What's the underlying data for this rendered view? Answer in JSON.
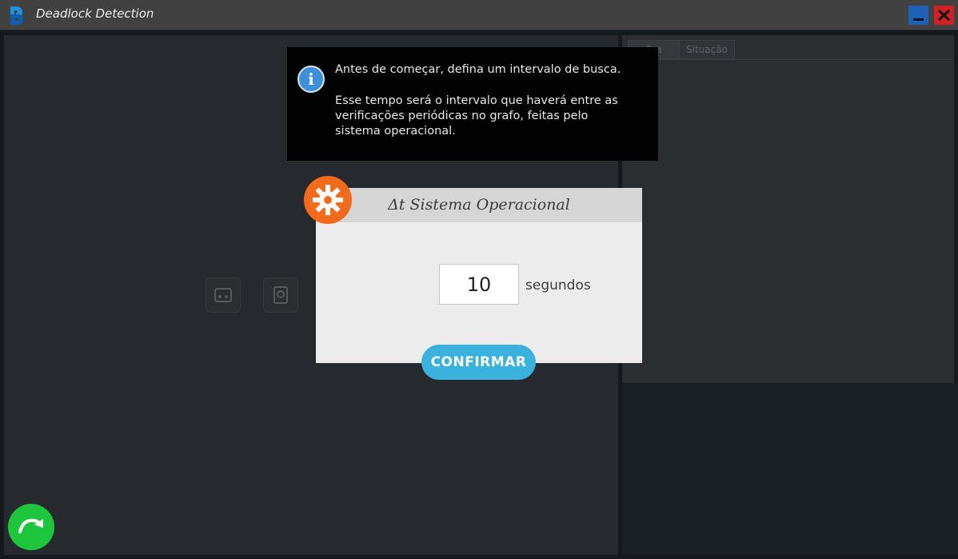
{
  "window": {
    "title": "Deadlock Detection",
    "minimize_icon": "minimize-icon",
    "close_icon": "close-icon"
  },
  "right_panel": {
    "tabs": [
      {
        "label": "Gra"
      },
      {
        "label": "Situação"
      }
    ]
  },
  "info": {
    "icon": "info-icon",
    "line1": "Antes de começar, defina um intervalo de busca.",
    "line2": "Esse tempo será o intervalo que haverá entre as\nverificações periódicas no grafo, feitas pelo\nsistema operacional."
  },
  "dialog": {
    "title": "Δt Sistema Operacional",
    "icon": "gear-icon",
    "interval_value": "10",
    "unit": "segundos",
    "confirm_label": "CONFIRMAR"
  },
  "colors": {
    "accent": "#3bb2de",
    "gear_badge": "#f26b1d",
    "next_button": "#1ec63b",
    "close_button": "#d02025",
    "minimize_button": "#1f5fb5"
  }
}
